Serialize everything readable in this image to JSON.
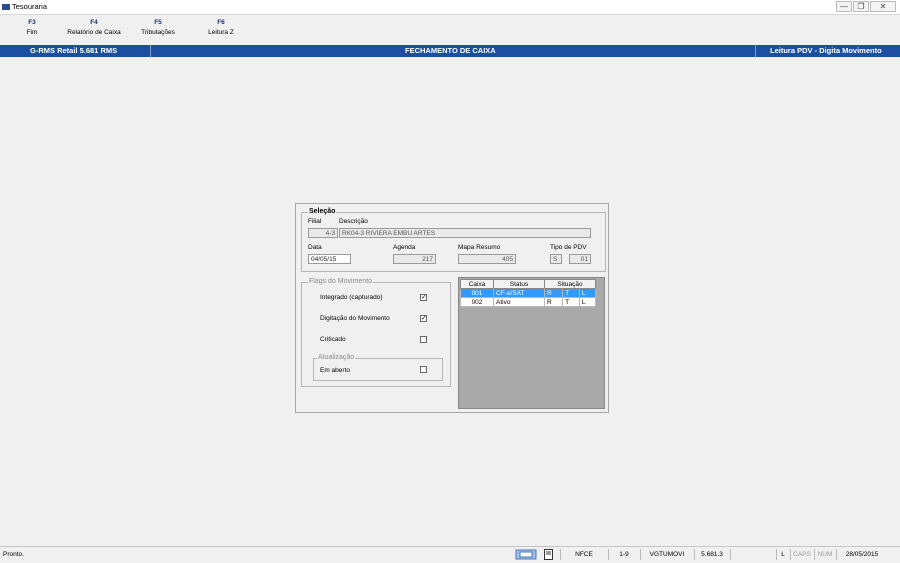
{
  "window": {
    "title": "Tesouraria",
    "min_glyph": "—",
    "max_glyph": "❐",
    "close_glyph": "✕"
  },
  "fkeys": [
    {
      "key": "F3",
      "label": "Fim"
    },
    {
      "key": "F4",
      "label": "Relatório de Caixa"
    },
    {
      "key": "F5",
      "label": "Tributações"
    },
    {
      "key": "F6",
      "label": "Leitura Z"
    }
  ],
  "header": {
    "left": "G-RMS Retail 5.681 RMS",
    "center": "FECHAMENTO DE CAIXA",
    "right": "Leitura PDV - Digita Movimento"
  },
  "selecao": {
    "title": "Seleção",
    "filial_label": "Filial",
    "filial_value": "4-3",
    "descricao_label": "Descrição",
    "descricao_value": "RK04-3 RIVIERA EMBU ARTES",
    "data_label": "Data",
    "data_value": "04/05/15",
    "agenda_label": "Agenda",
    "agenda_value": "217",
    "mapa_label": "Mapa Resumo",
    "mapa_value": "405",
    "tipo_label": "Tipo de PDV",
    "tipo_value1": "S",
    "tipo_value2": "01"
  },
  "flags": {
    "title": "Flags do Movimento",
    "items": [
      {
        "label": "Integrado (capturado)",
        "checked": true
      },
      {
        "label": "Digitação do Movimento",
        "checked": true
      },
      {
        "label": "Criticado",
        "checked": false
      }
    ],
    "atualizacao_title": "Atualização",
    "em_aberto_label": "Em aberto",
    "em_aberto_checked": false
  },
  "grid": {
    "headers": [
      "Caixa",
      "Status",
      "Situação"
    ],
    "rows": [
      {
        "caixa": "001",
        "status": "CF-e/SAT",
        "s1": "R",
        "s2": "T",
        "s3": "L",
        "selected": true
      },
      {
        "caixa": "002",
        "status": "Ativo",
        "s1": "R",
        "s2": "T",
        "s3": "L",
        "selected": false
      }
    ]
  },
  "status": {
    "text": "Pronto.",
    "cells": [
      "NFCE",
      "1-9",
      "VGTUMOVI",
      "5.681.3",
      "",
      "L",
      "CAPS",
      "NUM",
      "28/05/2015"
    ]
  }
}
